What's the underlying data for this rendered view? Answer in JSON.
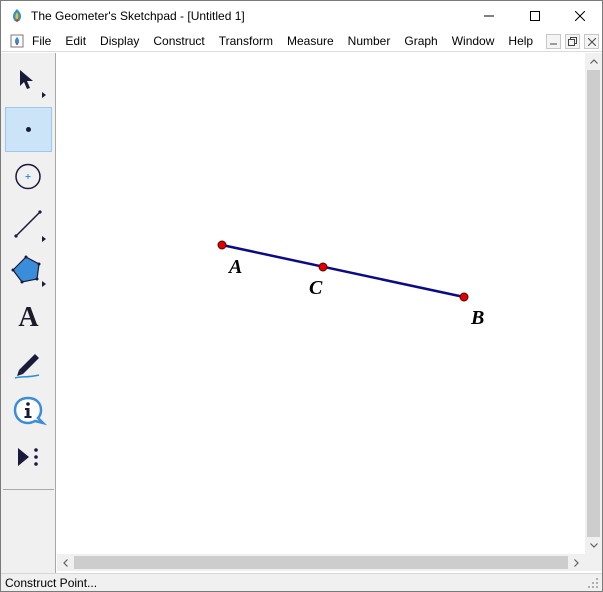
{
  "window": {
    "title": "The Geometer's Sketchpad - [Untitled 1]",
    "controls": [
      "minimize",
      "maximize",
      "close"
    ]
  },
  "menu": {
    "items": [
      "File",
      "Edit",
      "Display",
      "Construct",
      "Transform",
      "Measure",
      "Number",
      "Graph",
      "Window",
      "Help"
    ]
  },
  "toolbox": {
    "tools": [
      {
        "name": "Arrow Tool",
        "icon": "arrow-icon"
      },
      {
        "name": "Point Tool",
        "icon": "point-icon",
        "selected": true
      },
      {
        "name": "Compass Tool",
        "icon": "compass-icon"
      },
      {
        "name": "Straightedge Tool",
        "icon": "segment-icon"
      },
      {
        "name": "Polygon Tool",
        "icon": "polygon-icon"
      },
      {
        "name": "Text Tool",
        "icon": "text-icon",
        "glyph": "A"
      },
      {
        "name": "Marker Tool",
        "icon": "marker-icon"
      },
      {
        "name": "Information Tool",
        "icon": "info-icon"
      },
      {
        "name": "Custom Tools",
        "icon": "custom-tools-icon"
      }
    ]
  },
  "sketch": {
    "segment_color": "#0a0a8a",
    "point_color": "#e00000",
    "points": [
      {
        "label": "A"
      },
      {
        "label": "C"
      },
      {
        "label": "B"
      }
    ]
  },
  "status": {
    "text": "Construct Point..."
  }
}
